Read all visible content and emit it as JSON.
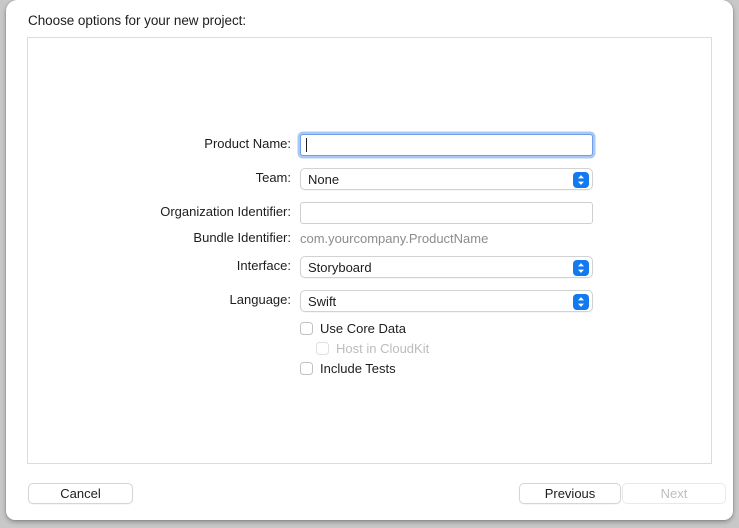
{
  "dialog": {
    "heading": "Choose options for your new project:"
  },
  "form": {
    "rows": [
      {
        "label": "Product Name:",
        "type": "textfield",
        "value": "",
        "placeholder": "",
        "focused": true
      },
      {
        "label": "Team:",
        "type": "popup",
        "value": "None"
      },
      {
        "label": "Organization Identifier:",
        "type": "textfield",
        "value": "",
        "placeholder": "",
        "focused": false
      },
      {
        "label": "Bundle Identifier:",
        "type": "static",
        "value": "com.yourcompany.ProductName"
      },
      {
        "label": "Interface:",
        "type": "popup",
        "value": "Storyboard"
      },
      {
        "label": "Language:",
        "type": "popup",
        "value": "Swift"
      }
    ],
    "checkboxes": [
      {
        "label": "Use Core Data",
        "checked": false,
        "disabled": false,
        "indent": false
      },
      {
        "label": "Host in CloudKit",
        "checked": false,
        "disabled": true,
        "indent": true
      },
      {
        "label": "Include Tests",
        "checked": false,
        "disabled": false,
        "indent": false
      }
    ]
  },
  "footer": {
    "cancel_label": "Cancel",
    "previous_label": "Previous",
    "next_label": "Next",
    "next_disabled": true
  },
  "colors": {
    "accent": "#1279ee",
    "focus_ring": "#6f9fe8",
    "disabled_text": "#bdbdbd",
    "static_text": "#8c8c8c",
    "window_bg": "#ffffff",
    "backdrop": "#c8c8c8"
  }
}
